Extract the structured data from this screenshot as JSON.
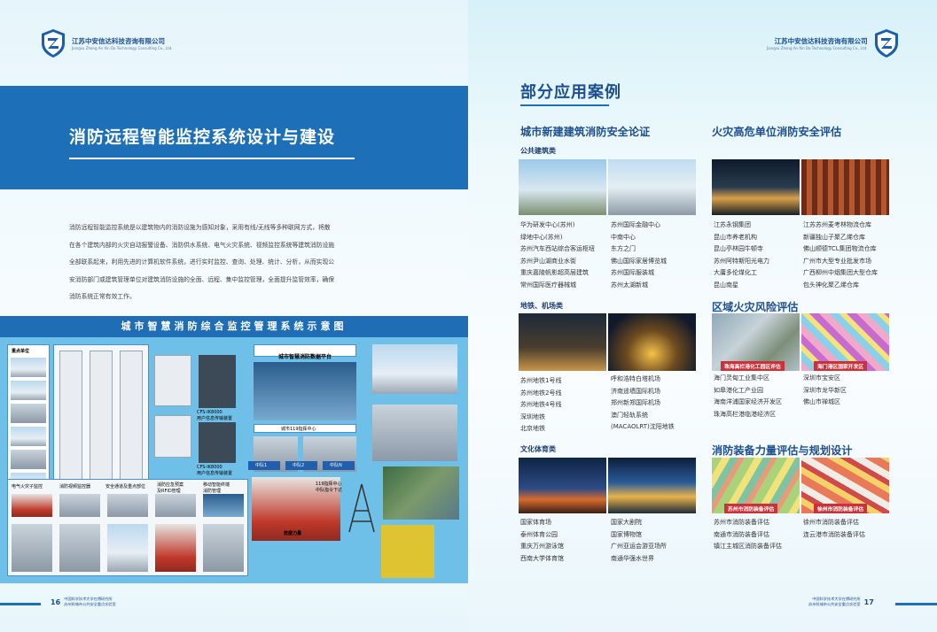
{
  "company": {
    "name_cn": "江苏中安信达科技咨询有限公司",
    "name_en": "Jiangsu Zhong An Xin Da Technology Consulting Co., Ltd."
  },
  "left": {
    "title": "消防远程智能监控系统设计与建设",
    "intro_lines": [
      "消防远程智能监控系统是以建筑物内的消防设施为感知对象，采用有线/无线等多种联网方式，将散",
      "在各个建筑内部的火灾自动报警设备、消防供水系统、电气火灾系统、视频监控系统等建筑消防设施",
      "全部联系起来，利用先进的计算机软件系统，进行实时监控、查询、处理、统计、分析，从而实现公",
      "安消防部门或建筑管理单位对建筑消防设施的全面、远程、集中监控管理，全面提升监管效率，确保",
      "消防系统正常有效工作。"
    ],
    "diagram": {
      "title": "城市智慧消防综合监控管理系统示意图",
      "key_units": "重点单位",
      "platform": "城市智慧消防数据平台",
      "center": "城市119指挥中心",
      "tags": [
        "中队1",
        "中队2",
        "中队N"
      ],
      "dispatch": "119指挥中心\n中队指令下达",
      "force": "救援力量",
      "bottom_labels": [
        "电气火灾子监控",
        "消防视频监控器",
        "安全通道及重点部位",
        "消防应急预案\n及RFID管理",
        "移动智能终端\n消防管理"
      ],
      "cfs1": "CFS-IK8000\n用户信息传输装置",
      "cfs2": "CFS-IK8000\n用户信息传输装置"
    },
    "footer": {
      "page": "16",
      "line1": "中国科学技术大学在博研究所",
      "line2": "苏州科城市公共安全重点实验室"
    }
  },
  "right": {
    "title": "部分应用案例",
    "sections": {
      "urban": {
        "title": "城市新建建筑消防安全论证",
        "public": {
          "subtitle": "公共建筑类",
          "col1": [
            "华为研发中心(苏州)",
            "绿地中心(苏州)",
            "苏州汽车西站综合客运枢纽",
            "苏州尹山湖商业水街",
            "重庆嘉陵帆影超高层建筑",
            "常州国际医疗器械城"
          ],
          "col2": [
            "苏州国际金融中心",
            "中南中心",
            "东方之门",
            "佛山国际家居博览城",
            "苏州国际服装城",
            "苏州太湖新城"
          ]
        },
        "metro": {
          "subtitle": "地铁、机场类",
          "col1": [
            "苏州地铁1号线",
            "苏州地铁2号线",
            "苏州地铁4号线",
            "深圳地铁",
            "北京地铁"
          ],
          "col2": [
            "呼和浩特白塔机场",
            "济南遥墙国际机场",
            "郑州新郑国际机场",
            "澳门轻轨系统",
            "(MACAOLRT)沈阳地铁"
          ]
        },
        "culture": {
          "subtitle": "文化体育类",
          "col1": [
            "国家体育场",
            "泰州体育公园",
            "重庆万州游泳馆",
            "西南大学体育馆"
          ],
          "col2": [
            "国家大剧院",
            "国家博物馆",
            "广州亚运会游亚场所",
            "南通华强水世界"
          ]
        }
      },
      "high_risk": {
        "title": "火灾高危单位消防安全评估",
        "col1": [
          "江苏永钢集团",
          "昆山市养老机构",
          "昆山亭林园牛顿寺",
          "苏州阿特斯阳光电力",
          "大庸多伦煤化工",
          "昆山南星"
        ],
        "col2": [
          "江苏苏州麦考林物流仓库",
          "新疆独山子聚乙烯仓库",
          "佛山顺德TCL集团物流仓库",
          "广州市大型专业批发市场",
          "广西柳州中烟集团大型仓库",
          "包头神化聚乙烯仓库"
        ]
      },
      "regional": {
        "title": "区域火灾风险评估",
        "img1_caption": "珠海高栏港化工园区评估",
        "img2_caption": "海门港区国家开发区",
        "col1": [
          "海门灵甸工业集中区",
          "如皋港化工产业园",
          "海南洋浦国家经济开发区",
          "珠海高栏港临港经济区"
        ],
        "col2": [
          "深圳市宝安区",
          "深圳市龙华新区",
          "佛山市禅城区"
        ]
      },
      "equipment": {
        "title": "消防装备力量评估与规划设计",
        "img1_caption": "苏州市消防装备评估",
        "img2_caption": "徐州市消防装备评估",
        "col1": [
          "苏州市消防装备评估",
          "南通市消防装备评估",
          "镇江主城区消防装备评估"
        ],
        "col2": [
          "徐州市消防装备评估",
          "连云港市消防装备评估"
        ]
      }
    },
    "footer": {
      "page": "17",
      "line1": "中国科学技术大学在博研究所",
      "line2": "苏州科城市公共安全重点实验室"
    }
  }
}
